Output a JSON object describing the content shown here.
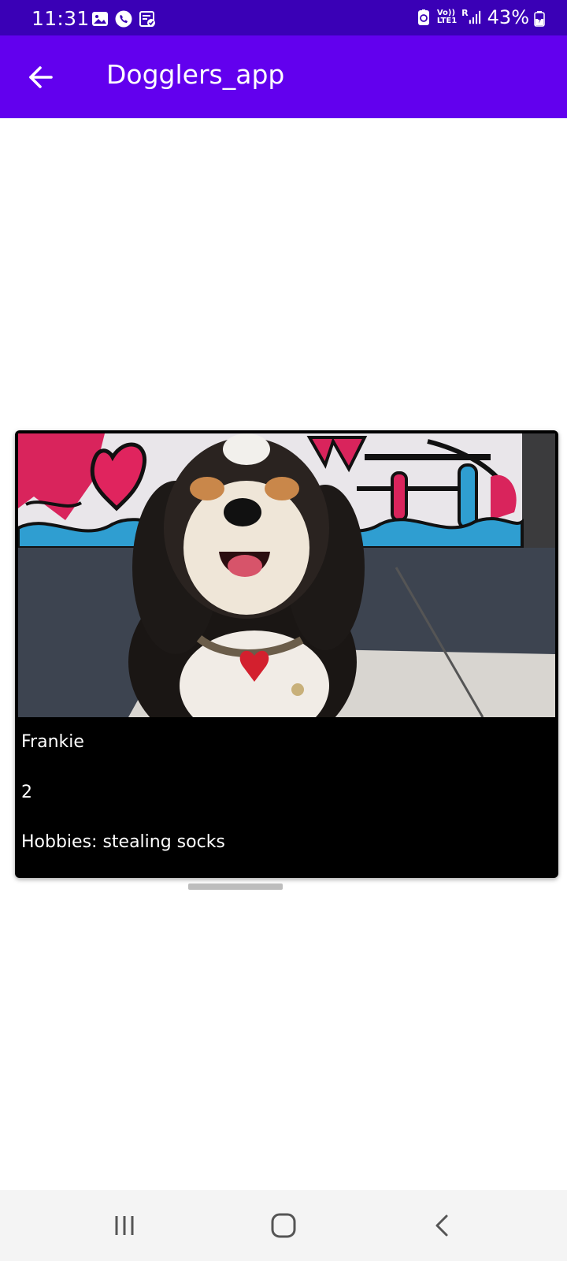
{
  "status_bar": {
    "time": "11:31",
    "battery_percent": "43%",
    "left_icons": [
      "gallery-icon",
      "phone-call-icon",
      "task-icon"
    ],
    "right_icons": [
      "data-saver-icon",
      "volte-icon",
      "signal-icon",
      "battery-icon"
    ],
    "volte_label_top": "Vo))",
    "volte_label_bottom": "LTE1",
    "roaming_label": "R"
  },
  "app_bar": {
    "title": "Dogglers_app",
    "back_icon": "arrow-back-icon"
  },
  "dog_card": {
    "name": "Frankie",
    "age": "2",
    "hobbies": "Hobbies: stealing socks",
    "photo_icon": "dog-photo"
  },
  "nav_bar": {
    "recents_icon": "recents-icon",
    "home_icon": "home-icon",
    "back_icon": "nav-back-icon"
  },
  "colors": {
    "status_bar": "#3a00b6",
    "app_bar": "#6200ee",
    "card_background": "#000000",
    "nav_bar": "#f4f4f4"
  }
}
